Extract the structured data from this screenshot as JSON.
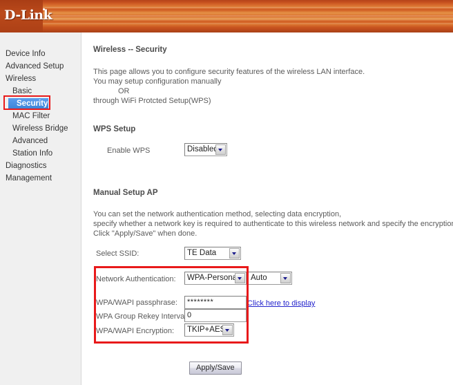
{
  "header": {
    "logo_text": "D-Link"
  },
  "sidebar": {
    "items": [
      {
        "label": "Device Info",
        "level": 0,
        "selected": false
      },
      {
        "label": "Advanced Setup",
        "level": 0,
        "selected": false
      },
      {
        "label": "Wireless",
        "level": 0,
        "selected": false
      },
      {
        "label": "Basic",
        "level": 1,
        "selected": false
      },
      {
        "label": "Security",
        "level": 1,
        "selected": true
      },
      {
        "label": "MAC Filter",
        "level": 1,
        "selected": false
      },
      {
        "label": "Wireless Bridge",
        "level": 1,
        "selected": false
      },
      {
        "label": "Advanced",
        "level": 1,
        "selected": false
      },
      {
        "label": "Station Info",
        "level": 1,
        "selected": false
      },
      {
        "label": "Diagnostics",
        "level": 0,
        "selected": false
      },
      {
        "label": "Management",
        "level": 0,
        "selected": false
      }
    ]
  },
  "main": {
    "page_title": "Wireless -- Security",
    "intro_line1": "This page allows you to configure security features of the wireless LAN interface.",
    "intro_line2": "You may setup configuration manually",
    "intro_line3": "OR",
    "intro_line4": "through WiFi Protcted Setup(WPS)",
    "wps": {
      "section_title": "WPS Setup",
      "enable_label": "Enable WPS",
      "enable_value": "Disabled"
    },
    "manual": {
      "section_title": "Manual Setup AP",
      "desc_line1": "You can set the network authentication method, selecting data encryption,",
      "desc_line2": "specify whether a network key is required to authenticate to this wireless network and specify the encryption strength.",
      "desc_line3": "Click \"Apply/Save\" when done.",
      "ssid_label": "Select SSID:",
      "ssid_value": "TE Data",
      "auth_label": "Network Authentication:",
      "auth_value": "WPA-Personal",
      "auth_mode_value": "Auto",
      "passphrase_label": "WPA/WAPI passphrase:",
      "passphrase_value": "********",
      "passphrase_link": "Click here to display",
      "rekey_label": "WPA Group Rekey Interval:",
      "rekey_value": "0",
      "encryption_label": "WPA/WAPI Encryption:",
      "encryption_value": "TKIP+AES"
    },
    "apply_button": "Apply/Save"
  },
  "annotations": {
    "accent_color": "#e8191a",
    "highlight_color": "#4a90e2"
  }
}
